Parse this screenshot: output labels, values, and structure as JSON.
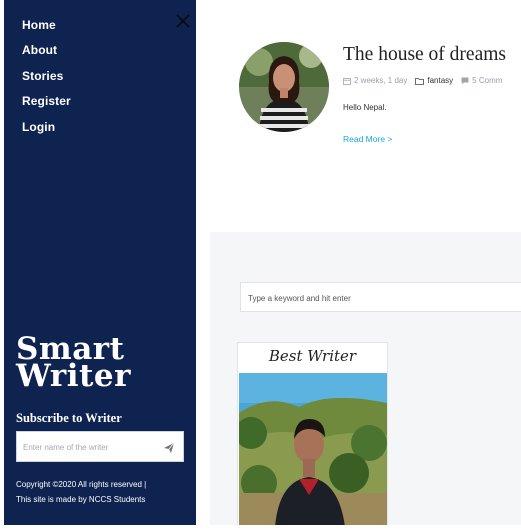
{
  "sidebar": {
    "nav": [
      "Home",
      "About",
      "Stories",
      "Register",
      "Login"
    ],
    "brand_line1": "Smart",
    "brand_line2": "Writer",
    "subscribe_title": "Subscribe to Writer",
    "subscribe_placeholder": "Enter name of the writer",
    "copyright_line1": "Copyright ©2020 All rights reserved |",
    "copyright_line2": "This site is made by NCCS Students",
    "colors": {
      "background": "#0f2350",
      "text": "#ffffff"
    },
    "icons": {
      "close": "close-icon",
      "send": "send-icon"
    }
  },
  "post": {
    "title": "The house of dreams",
    "date": "2 weeks, 1 day",
    "category": "fantasy",
    "comments": "5 Comm",
    "excerpt": "Hello Nepal.",
    "read_more": "Read More >",
    "colors": {
      "link": "#1aa7d8"
    },
    "icons": {
      "date": "calendar-icon",
      "category": "folder-icon",
      "comments": "comment-icon"
    }
  },
  "search": {
    "placeholder": "Type a keyword and hit enter"
  },
  "best_writer": {
    "title": "Best Writer"
  }
}
